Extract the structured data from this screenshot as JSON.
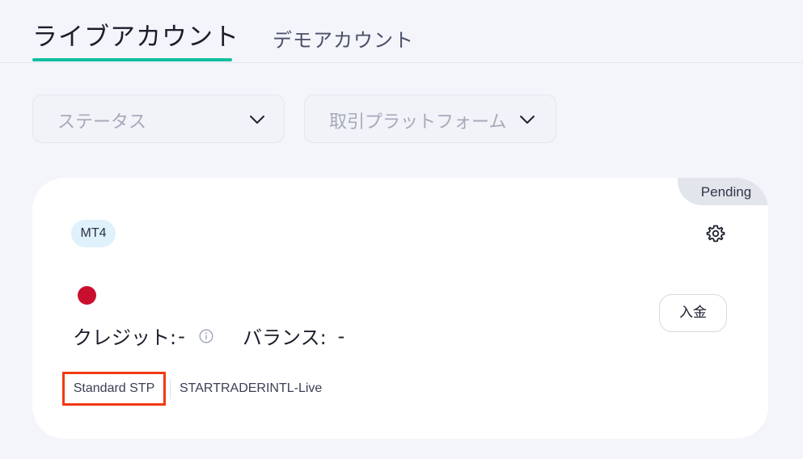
{
  "tabs": {
    "live": "ライブアカウント",
    "demo": "デモアカウント"
  },
  "filters": {
    "status": "ステータス",
    "platform": "取引プラットフォーム"
  },
  "account_card": {
    "status_badge": "Pending",
    "platform": "MT4",
    "credit_label": "クレジット:",
    "credit_value": "-",
    "balance_label": "バランス:",
    "balance_value": "-",
    "deposit_button": "入金",
    "account_type": "Standard STP",
    "server": "STARTRADERINTL-Live",
    "flag_icon": "japan-flag-icon",
    "settings_icon": "gear-icon",
    "info_icon": "info-icon"
  },
  "colors": {
    "accent": "#0fbf9f",
    "highlight_box": "#f13a13",
    "flag": "#c8102e",
    "chip_bg": "#dff1fa"
  }
}
